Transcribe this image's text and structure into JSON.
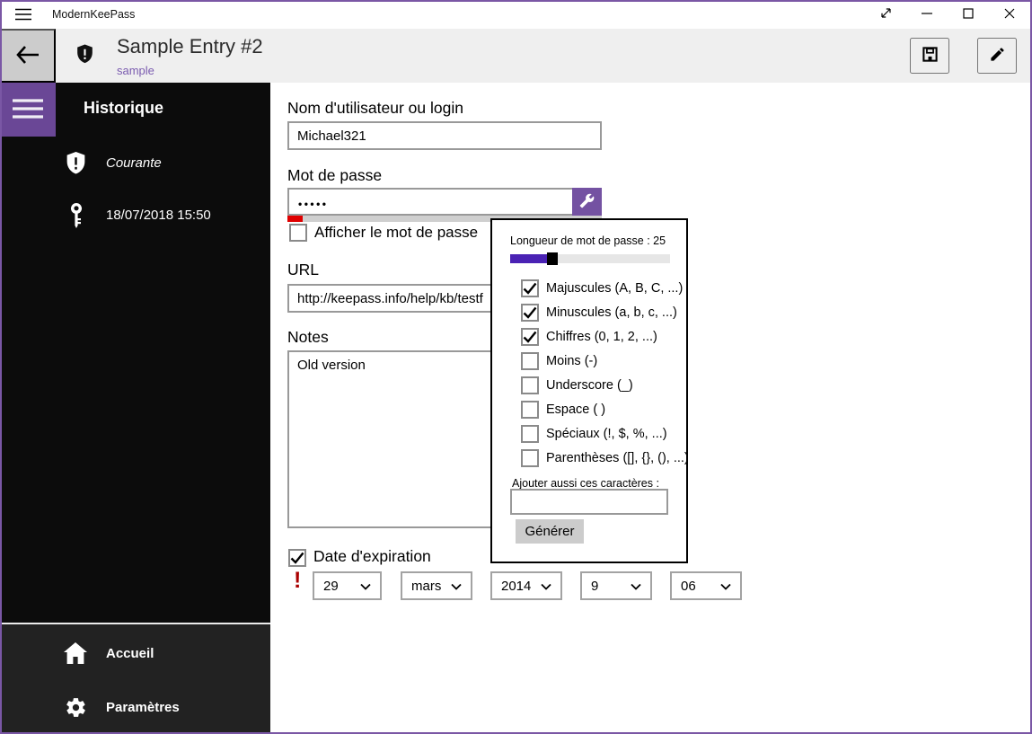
{
  "titlebar": {
    "app_title": "ModernKeePass",
    "control_icons": [
      "fullscreen-icon",
      "minimize-icon",
      "maximize-icon",
      "close-icon"
    ]
  },
  "header": {
    "title": "Sample Entry #2",
    "subtitle": "sample",
    "icons": [
      "shield-icon",
      "save-icon",
      "edit-pencil-icon"
    ]
  },
  "sidebar": {
    "heading": "Historique",
    "items": [
      {
        "icon": "shield-icon",
        "label": "Courante"
      },
      {
        "icon": "key-icon",
        "label": "18/07/2018 15:50"
      }
    ],
    "footer": [
      {
        "icon": "home-icon",
        "label": "Accueil"
      },
      {
        "icon": "gear-icon",
        "label": "Paramètres"
      }
    ]
  },
  "form": {
    "username_label": "Nom d'utilisateur ou login",
    "username_value": "Michael321",
    "password_label": "Mot de passe",
    "password_value": "•••••",
    "show_password_label": "Afficher le mot de passe",
    "show_password_checked": false,
    "url_label": "URL",
    "url_value": "http://keepass.info/help/kb/testf",
    "notes_label": "Notes",
    "notes_value": "Old version",
    "expiration_label": "Date d'expiration",
    "expiration_checked": true,
    "expiration_warning": "!",
    "date_parts": {
      "day": "29",
      "month": "mars",
      "year": "2014",
      "hour": "9",
      "minute": "06"
    }
  },
  "generator": {
    "length_label": "Longueur de mot de passe : 25",
    "length_value": 25,
    "slider_percent": 23,
    "options": [
      {
        "label": "Majuscules (A, B, C, ...)",
        "checked": true
      },
      {
        "label": "Minuscules (a, b, c, ...)",
        "checked": true
      },
      {
        "label": "Chiffres (0, 1, 2, ...)",
        "checked": true
      },
      {
        "label": "Moins (-)",
        "checked": false
      },
      {
        "label": "Underscore (_)",
        "checked": false
      },
      {
        "label": "Espace ( )",
        "checked": false
      },
      {
        "label": "Spéciaux (!, $, %, ...)",
        "checked": false
      },
      {
        "label": "Parenthèses ([], {}, (), ...)",
        "checked": false
      }
    ],
    "extra_label": "Ajouter aussi ces caractères :",
    "extra_value": "",
    "generate_label": "Générer"
  },
  "colors": {
    "accent": "#6a4796",
    "accent_button": "#7452a2",
    "slider_fill": "#4a22b4",
    "subtitle_purple": "#7b5cb0",
    "window_border": "#7a57a5",
    "strength_red": "#e00000",
    "warning_red": "#aa0000",
    "sidebar_bg": "#0c0c0c",
    "sidebar_footer_bg": "#222222",
    "header_bg": "#efefef"
  }
}
